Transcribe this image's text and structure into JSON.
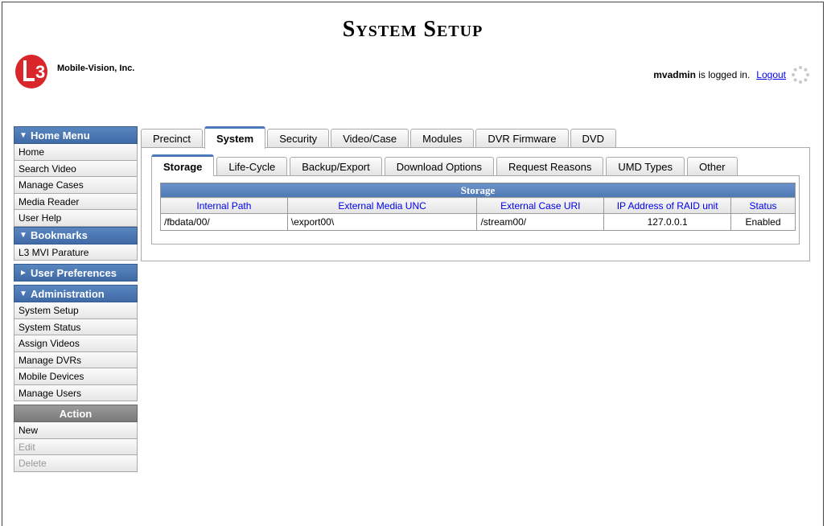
{
  "header": {
    "title": "System Setup",
    "logo_text": "Mobile-Vision, Inc.",
    "logo_badge": "L3",
    "user_name": "mvadmin",
    "logged_in_text": " is logged in.",
    "logout_label": "Logout"
  },
  "sidebar": {
    "home_menu": {
      "title": "Home Menu",
      "items": [
        "Home",
        "Search Video",
        "Manage Cases",
        "Media Reader",
        "User Help"
      ]
    },
    "bookmarks": {
      "title": "Bookmarks",
      "items": [
        "L3 MVI Parature"
      ]
    },
    "user_preferences": {
      "title": "User Preferences"
    },
    "administration": {
      "title": "Administration",
      "items": [
        "System Setup",
        "System Status",
        "Assign Videos",
        "Manage DVRs",
        "Mobile Devices",
        "Manage Users"
      ]
    },
    "action": {
      "title": "Action",
      "items": [
        "New",
        "Edit",
        "Delete"
      ]
    }
  },
  "tabs": [
    "Precinct",
    "System",
    "Security",
    "Video/Case",
    "Modules",
    "DVR Firmware",
    "DVD"
  ],
  "subtabs": [
    "Storage",
    "Life-Cycle",
    "Backup/Export",
    "Download Options",
    "Request Reasons",
    "UMD Types",
    "Other"
  ],
  "storage_table": {
    "caption": "Storage",
    "columns": [
      "Internal Path",
      "External Media UNC",
      "External Case URI",
      "IP Address of RAID unit",
      "Status"
    ],
    "rows": [
      [
        "/fbdata/00/",
        "\\export00\\",
        "/stream00/",
        "127.0.0.1",
        "Enabled"
      ]
    ]
  },
  "colors": {
    "section_header": "#4a78b8",
    "link": "#0000ee",
    "action_header": "#888888"
  }
}
